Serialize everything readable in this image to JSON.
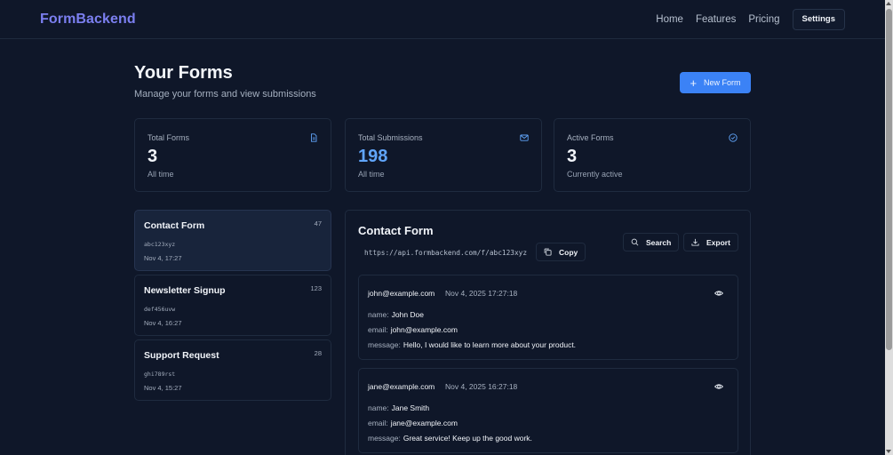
{
  "nav": {
    "logo": "FormBackend",
    "links": [
      "Home",
      "Features",
      "Pricing"
    ],
    "settings_label": "Settings"
  },
  "header": {
    "title": "Your Forms",
    "subtitle": "Manage your forms and view submissions",
    "new_form_label": "New Form"
  },
  "stats": [
    {
      "label": "Total Forms",
      "value": "3",
      "foot": "All time",
      "icon": "document-icon"
    },
    {
      "label": "Total Submissions",
      "value": "198",
      "foot": "All time",
      "icon": "mail-icon"
    },
    {
      "label": "Active Forms",
      "value": "3",
      "foot": "Currently active",
      "icon": "check-circle-icon"
    }
  ],
  "forms": [
    {
      "name": "Contact Form",
      "count": "47",
      "slug": "abc123xyz",
      "date": "Nov 4, 17:27"
    },
    {
      "name": "Newsletter Signup",
      "count": "123",
      "slug": "def456uvw",
      "date": "Nov 4, 16:27"
    },
    {
      "name": "Support Request",
      "count": "28",
      "slug": "ghi789rst",
      "date": "Nov 4, 15:27"
    }
  ],
  "detail": {
    "title": "Contact Form",
    "endpoint": "https://api.formbackend.com/f/abc123xyz",
    "copy_label": "Copy",
    "search_label": "Search",
    "export_label": "Export",
    "submissions": [
      {
        "email": "john@example.com",
        "time": "Nov 4, 2025 17:27:18",
        "fields": [
          {
            "key": "name:",
            "value": "John Doe"
          },
          {
            "key": "email:",
            "value": "john@example.com"
          },
          {
            "key": "message:",
            "value": "Hello, I would like to learn more about your product."
          }
        ]
      },
      {
        "email": "jane@example.com",
        "time": "Nov 4, 2025 16:27:18",
        "fields": [
          {
            "key": "name:",
            "value": "Jane Smith"
          },
          {
            "key": "email:",
            "value": "jane@example.com"
          },
          {
            "key": "message:",
            "value": "Great service! Keep up the good work."
          }
        ]
      }
    ]
  },
  "colors": {
    "background": "#0f1729",
    "accent": "#3b82f6",
    "logo": "#7b7ff0",
    "highlight_value": "#60a5fa"
  }
}
